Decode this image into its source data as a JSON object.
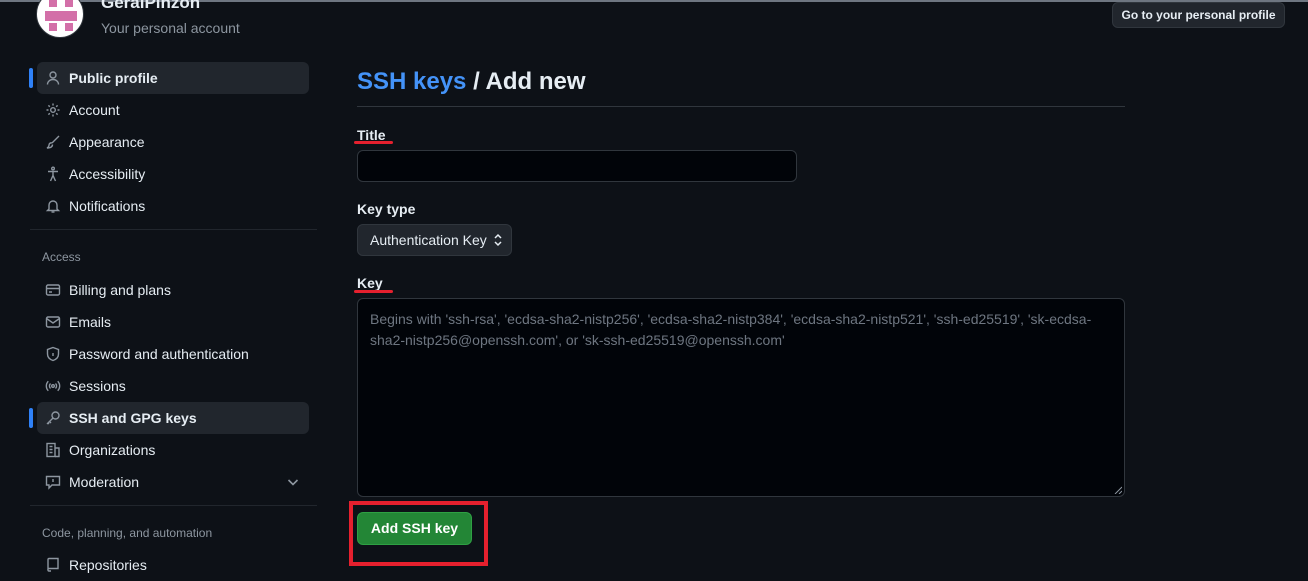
{
  "account": {
    "name": "GeralPinzon",
    "subtitle": "Your personal account",
    "profile_button": "Go to your personal profile"
  },
  "sidebar": {
    "items": [
      {
        "label": "Public profile",
        "icon": "person-icon",
        "active": true
      },
      {
        "label": "Account",
        "icon": "gear-icon"
      },
      {
        "label": "Appearance",
        "icon": "paintbrush-icon"
      },
      {
        "label": "Accessibility",
        "icon": "accessibility-icon"
      },
      {
        "label": "Notifications",
        "icon": "bell-icon"
      }
    ],
    "access_heading": "Access",
    "access_items": [
      {
        "label": "Billing and plans",
        "icon": "credit-card-icon"
      },
      {
        "label": "Emails",
        "icon": "mail-icon"
      },
      {
        "label": "Password and authentication",
        "icon": "shield-lock-icon"
      },
      {
        "label": "Sessions",
        "icon": "broadcast-icon"
      },
      {
        "label": "SSH and GPG keys",
        "icon": "key-icon",
        "active": true
      },
      {
        "label": "Organizations",
        "icon": "organization-icon"
      },
      {
        "label": "Moderation",
        "icon": "report-icon",
        "expandable": true
      }
    ],
    "code_heading": "Code, planning, and automation",
    "code_items": [
      {
        "label": "Repositories",
        "icon": "repo-icon"
      }
    ]
  },
  "main": {
    "breadcrumb": "SSH keys",
    "title_rest": " / Add new",
    "title_label": "Title",
    "title_value": "",
    "key_type_label": "Key type",
    "key_type_value": "Authentication Key",
    "key_label": "Key",
    "key_placeholder": "Begins with 'ssh-rsa', 'ecdsa-sha2-nistp256', 'ecdsa-sha2-nistp384', 'ecdsa-sha2-nistp521', 'ssh-ed25519', 'sk-ecdsa-sha2-nistp256@openssh.com', or 'sk-ssh-ed25519@openssh.com'",
    "submit_label": "Add SSH key"
  },
  "colors": {
    "background": "#0d1117",
    "accent_link": "#4493f8",
    "active_bar": "#2f81f7",
    "primary_button": "#238636",
    "annotation_red": "#e5202e"
  }
}
